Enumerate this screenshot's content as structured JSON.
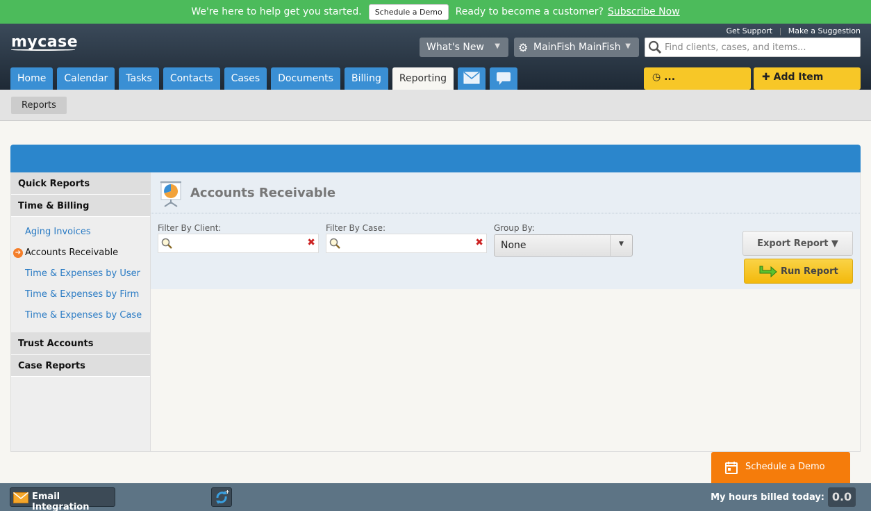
{
  "promo": {
    "help_text": "We're here to help get you started.",
    "demo_button": "Schedule a Demo",
    "ready_text": "Ready to become a customer?",
    "subscribe_link": "Subscribe Now",
    "bg_color": "#4cbb5b"
  },
  "header": {
    "logo": "mycase",
    "get_support": "Get Support",
    "make_suggestion": "Make a Suggestion",
    "whats_new": "What's New",
    "user_name": "MainFish MainFish",
    "search_placeholder": "Find clients, cases, and items...",
    "tabs": [
      {
        "label": "Home"
      },
      {
        "label": "Calendar"
      },
      {
        "label": "Tasks"
      },
      {
        "label": "Contacts"
      },
      {
        "label": "Cases"
      },
      {
        "label": "Documents"
      },
      {
        "label": "Billing"
      },
      {
        "label": "Reporting",
        "active": true
      }
    ],
    "icon_tabs": [
      "envelope-icon",
      "chat-icon"
    ],
    "recent_button": "...",
    "add_item_button": "Add Item"
  },
  "breadcrumb": {
    "label": "Reports"
  },
  "sidebar": {
    "sections": [
      {
        "label": "Quick Reports"
      },
      {
        "label": "Time & Billing"
      },
      {
        "label": "Trust Accounts"
      },
      {
        "label": "Case Reports"
      }
    ],
    "time_billing_items": [
      {
        "label": "Aging Invoices"
      },
      {
        "label": "Accounts Receivable",
        "current": true
      },
      {
        "label": "Time & Expenses by User"
      },
      {
        "label": "Time & Expenses by Firm"
      },
      {
        "label": "Time & Expenses by Case"
      }
    ]
  },
  "report": {
    "title": "Accounts Receivable",
    "filter_client_label": "Filter By Client:",
    "filter_client_value": "",
    "filter_case_label": "Filter By Case:",
    "filter_case_value": "",
    "group_by_label": "Group By:",
    "group_by_value": "None",
    "export_button": "Export Report ▼",
    "run_button": "Run Report"
  },
  "floating": {
    "schedule_demo": "Schedule a Demo"
  },
  "footer": {
    "email_integration": "Email Integration",
    "hours_label": "My hours billed today:",
    "hours_value": "0.0"
  },
  "colors": {
    "tab_blue": "#3a8fd4",
    "accent_yellow": "#f7c727",
    "demo_orange": "#f57c0b",
    "link_blue": "#2a7bc4"
  }
}
